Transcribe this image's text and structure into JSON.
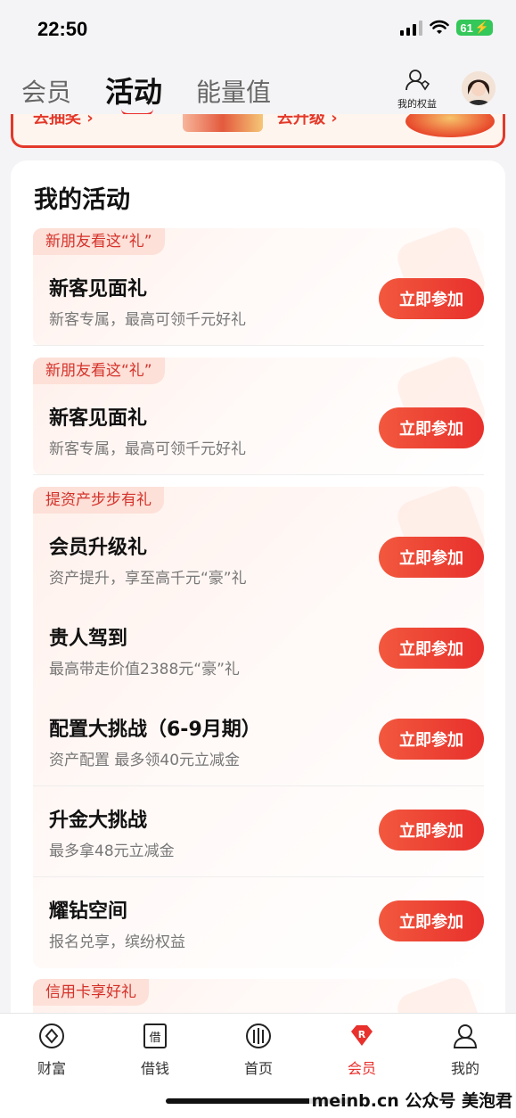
{
  "status_bar": {
    "time": "22:50",
    "battery": "61"
  },
  "top_nav": {
    "tabs": [
      {
        "label": "会员"
      },
      {
        "label": "活动"
      },
      {
        "label": "能量值"
      }
    ],
    "benefit_label": "我的权益"
  },
  "banner": {
    "left_text": "去抽奖 ›",
    "right_text": "去升级 ›"
  },
  "card": {
    "title": "我的活动",
    "groups": [
      {
        "tag": "新朋友看这“礼”",
        "items": [
          {
            "title": "新客见面礼",
            "desc": "新客专属，最高可领千元好礼",
            "button": "立即参加"
          }
        ]
      },
      {
        "tag": "新朋友看这“礼”",
        "items": [
          {
            "title": "新客见面礼",
            "desc": "新客专属，最高可领千元好礼",
            "button": "立即参加"
          }
        ]
      },
      {
        "tag": "提资产步步有礼",
        "items": [
          {
            "title": "会员升级礼",
            "desc": "资产提升，享至高千元“豪”礼",
            "button": "立即参加"
          },
          {
            "title": "贵人驾到",
            "desc": "最高带走价值2388元“豪”礼",
            "button": "立即参加"
          },
          {
            "title": "配置大挑战（6-9月期）",
            "desc": "资产配置 最多领40元立减金",
            "button": "立即参加"
          },
          {
            "title": "升金大挑战",
            "desc": "最多拿48元立减金",
            "button": "立即参加"
          },
          {
            "title": "耀钻空间",
            "desc": "报名兑享，缤纷权益",
            "button": "立即参加"
          }
        ]
      },
      {
        "tag": "信用卡享好礼",
        "items": []
      }
    ]
  },
  "bottom_nav": {
    "items": [
      {
        "label": "财富",
        "icon": "wealth-icon"
      },
      {
        "label": "借钱",
        "icon": "borrow-icon"
      },
      {
        "label": "首页",
        "icon": "home-icon"
      },
      {
        "label": "会员",
        "icon": "member-icon"
      },
      {
        "label": "我的",
        "icon": "profile-icon"
      }
    ],
    "active_index": 3
  },
  "overlay_text": "meinb.cn 公众号 美泡君",
  "colors": {
    "accent": "#e8302c",
    "tag_bg": "#fde0d8",
    "page_bg": "#f4f4f6"
  }
}
